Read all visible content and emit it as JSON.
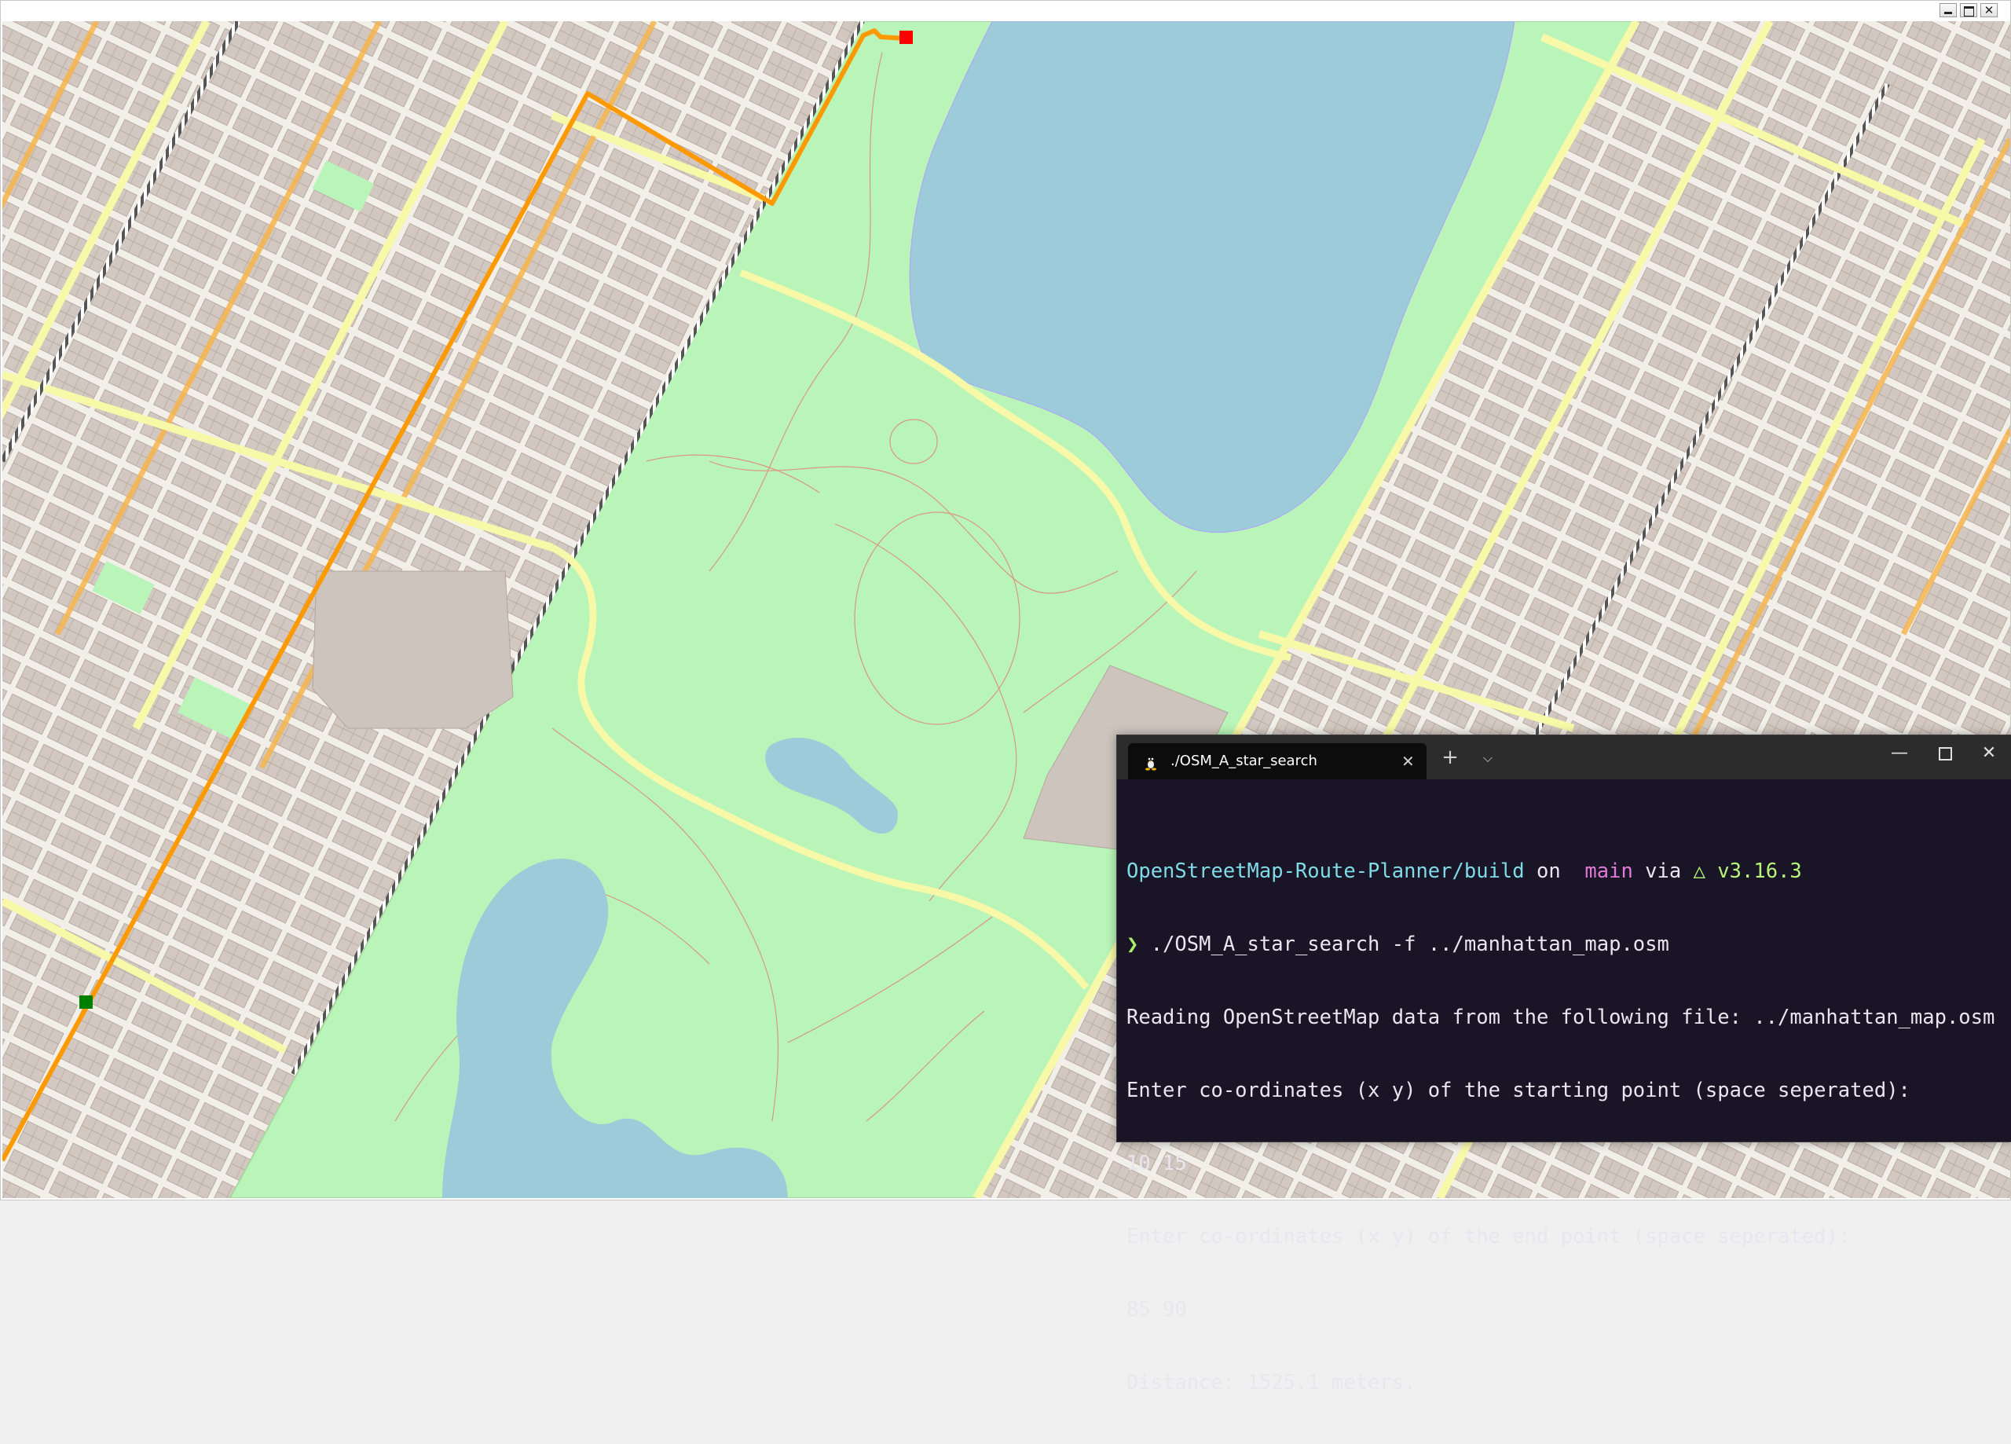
{
  "window": {
    "controls": {
      "minimize": "–",
      "maximize": "□",
      "close": "✕"
    }
  },
  "map": {
    "route": {
      "start_marker_color": "#008000",
      "end_marker_color": "#ff0000",
      "route_color": "#ff9900"
    },
    "colors": {
      "land": "#f2efe9",
      "park": "#b9f5b8",
      "water": "#9ccbd9",
      "building": "#cdc4bd",
      "major_road": "#f6b54d",
      "secondary_road": "#f7f9a8",
      "footway": "#e07a6a",
      "rail": "#555555"
    }
  },
  "terminal": {
    "tab_title": "./OSM_A_star_search",
    "tab_icon": "linux-tux-icon",
    "new_tab": "+",
    "dropdown": "⌵",
    "controls": {
      "minimize": "—",
      "close": "✕"
    },
    "prompt": {
      "path": "OpenStreetMap-Route-Planner/build",
      "on": " on ",
      "branch_icon": "",
      "branch": " main",
      "via": " via ",
      "cmake_icon": "△",
      "version": " v3.16.3",
      "arrow": "❯",
      "command": " ./OSM_A_star_search -f ../manhattan_map.osm"
    },
    "output": [
      "Reading OpenStreetMap data from the following file: ../manhattan_map.osm",
      "Enter co-ordinates (x y) of the starting point (space seperated):",
      "10 15",
      "Enter co-ordinates (x y) of the end point (space seperated):",
      "85 90",
      "Distance: 1525.1 meters."
    ]
  }
}
